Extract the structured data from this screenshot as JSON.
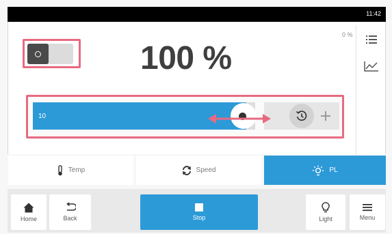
{
  "status_bar": {
    "time": "11:42"
  },
  "main": {
    "value_display": "100 %",
    "small_percent": "0 %",
    "slider_value": "10"
  },
  "tabs": [
    {
      "label": "Temp",
      "icon": "thermometer-icon",
      "active": false
    },
    {
      "label": "Speed",
      "icon": "speed-icon",
      "active": false
    },
    {
      "label": "PL",
      "icon": "light-icon",
      "active": true
    }
  ],
  "bottom_nav": {
    "home": "Home",
    "back": "Back",
    "stop": "Stop",
    "light": "Light",
    "menu": "Menu"
  },
  "colors": {
    "accent": "#2d9ad8",
    "highlight": "#e76a80",
    "text_dark": "#3f3f3f"
  }
}
